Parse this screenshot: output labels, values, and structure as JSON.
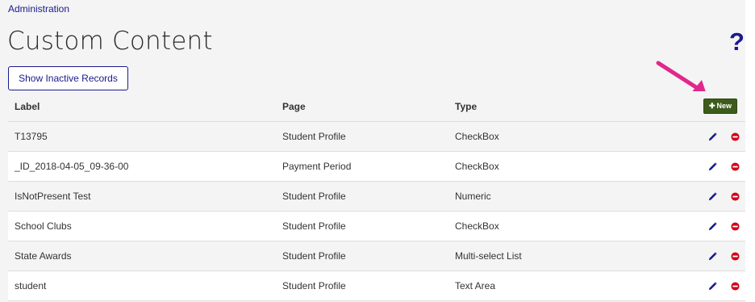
{
  "breadcrumb": "Administration",
  "page_title": "Custom Content",
  "help_icon": "?",
  "inactive_button": "Show Inactive Records",
  "new_button": "New",
  "colors": {
    "brand": "#1a1a8c",
    "new_button": "#3d5c1a",
    "delete_icon": "#d0021b",
    "arrow": "#e0288c"
  },
  "table": {
    "headers": {
      "label": "Label",
      "page": "Page",
      "type": "Type"
    },
    "rows": [
      {
        "label": "T13795",
        "page": "Student Profile",
        "type": "CheckBox"
      },
      {
        "label": "_ID_2018-04-05_09-36-00",
        "page": "Payment Period",
        "type": "CheckBox"
      },
      {
        "label": "IsNotPresent Test",
        "page": "Student Profile",
        "type": "Numeric"
      },
      {
        "label": "School Clubs",
        "page": "Student Profile",
        "type": "CheckBox"
      },
      {
        "label": "State Awards",
        "page": "Student Profile",
        "type": "Multi-select List"
      },
      {
        "label": "student",
        "page": "Student Profile",
        "type": "Text Area"
      }
    ]
  },
  "icons": {
    "edit": "pencil-icon",
    "delete": "minus-circle-icon",
    "new": "plus-icon",
    "help": "question-icon",
    "annotation": "arrow-icon"
  }
}
